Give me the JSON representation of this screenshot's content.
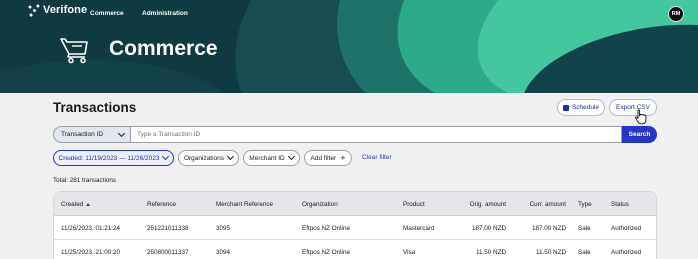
{
  "nav": {
    "brand": "Verifone",
    "items": [
      "Commerce",
      "Administration"
    ],
    "user_initials": "RM"
  },
  "hero": {
    "title": "Commerce",
    "icon": "shopping-cart-icon"
  },
  "page": {
    "title": "Transactions",
    "schedule_label": "Schedule",
    "export_label": "Export CSV",
    "total_text": "Total: 281 transactions"
  },
  "search": {
    "field_label": "Transaction ID",
    "placeholder": "Type a Transaction ID",
    "button_label": "Search"
  },
  "filters": {
    "created": "Created: 11/19/2023 — 11/26/2023",
    "organizations": "Organizations",
    "merchant_id": "Merchant ID",
    "add_filter": "Add filter",
    "clear_filter": "Clear filter"
  },
  "table": {
    "columns": [
      "Created",
      "Reference",
      "Merchant Reference",
      "Organization",
      "Product",
      "Orig. amount",
      "Curr. amount",
      "Type",
      "Status"
    ],
    "rows": [
      [
        "11/26/2023, 01:21:24",
        "251221011338",
        "3095",
        "Eftpos NZ Online",
        "Mastercard",
        "187.00 NZD",
        "187.00 NZD",
        "Sale",
        "Authorized"
      ],
      [
        "11/25/2023, 21:00:20",
        "250800011337",
        "3094",
        "Eftpos NZ Online",
        "Visa",
        "11.50 NZD",
        "11.50 NZD",
        "Sale",
        "Authorized"
      ]
    ]
  },
  "colors": {
    "accent": "#2535c6",
    "hero_dark": "#0f3a40",
    "hero_teal": "#31b08f"
  }
}
